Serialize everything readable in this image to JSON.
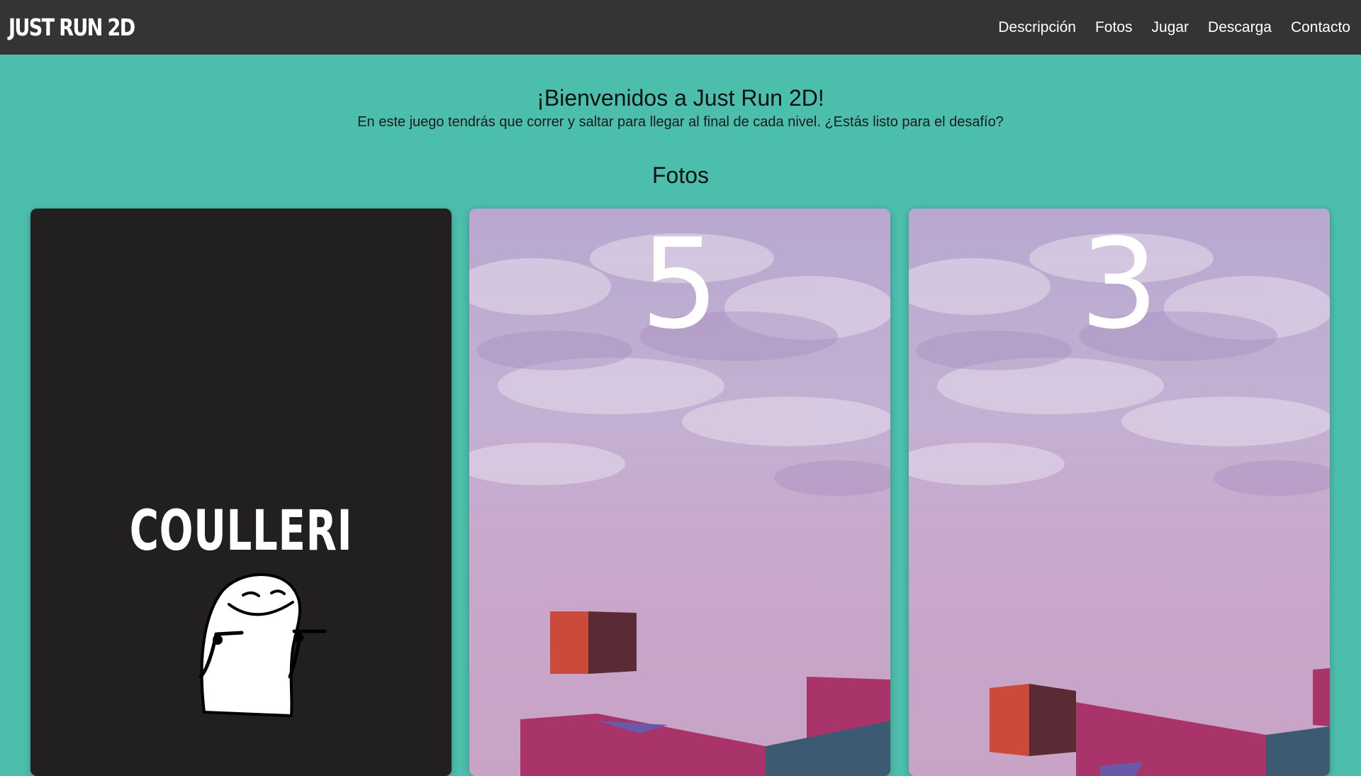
{
  "navbar": {
    "brand": "JUST RUN 2D",
    "links": [
      "Descripción",
      "Fotos",
      "Jugar",
      "Descarga",
      "Contacto"
    ]
  },
  "welcome": {
    "title": "¡Bienvenidos a Just Run 2D!",
    "subtitle": "En este juego tendrás que correr y saltar para llegar al final de cada nivel. ¿Estás listo para el desafío?"
  },
  "photos": {
    "title": "Fotos",
    "cards": [
      {
        "logo_text": "COULLERI"
      },
      {
        "level_number": "5"
      },
      {
        "level_number": "3"
      }
    ]
  },
  "colors": {
    "page_background": "#4cbfac",
    "navbar_background": "#343434",
    "card_dark": "#221f21"
  }
}
